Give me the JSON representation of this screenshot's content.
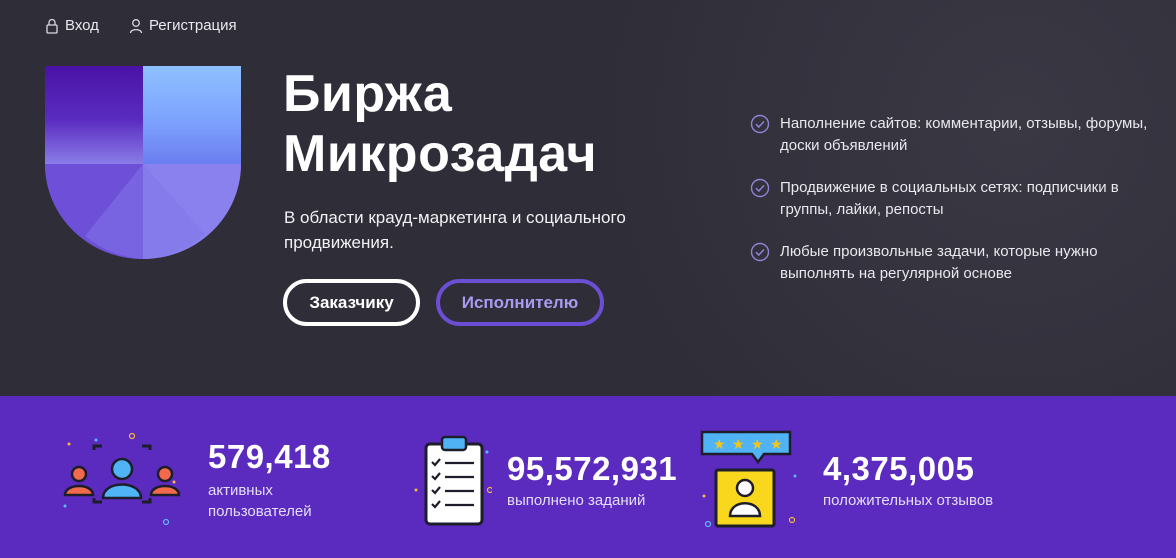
{
  "nav": {
    "login_label": "Вход",
    "register_label": "Регистрация"
  },
  "hero": {
    "title_line1": "Биржа",
    "title_line2": "Микрозадач",
    "subtitle": "В области крауд-маркетинга и социального продвижения.",
    "customer_button": "Заказчику",
    "executor_button": "Исполнителю"
  },
  "features": [
    {
      "text": "Наполнение сайтов: комментарии, отзывы, форумы, доски объявлений",
      "icon": "check-circle-icon"
    },
    {
      "text": "Продвижение в социальных сетях: подписчики в группы, лайки, репосты",
      "icon": "check-circle-icon"
    },
    {
      "text": "Любые произвольные задачи, которые нужно выполнять на регулярной основе",
      "icon": "check-circle-icon"
    }
  ],
  "stats": [
    {
      "value": "579,418",
      "label_line1": "активных",
      "label_line2": "пользователей",
      "icon": "users-icon"
    },
    {
      "value": "95,572,931",
      "label_line1": "выполнено заданий",
      "icon": "clipboard-checklist-icon"
    },
    {
      "value": "4,375,005",
      "label_line1": "положительных отзывов",
      "icon": "rated-profile-icon"
    }
  ],
  "colors": {
    "hero_bg": "#2f2d37",
    "stats_bg": "#5b2bbf",
    "accent_purple": "#6a4fd4",
    "logo_light": "#8fb8ff",
    "logo_dark": "#4a1aa8"
  }
}
